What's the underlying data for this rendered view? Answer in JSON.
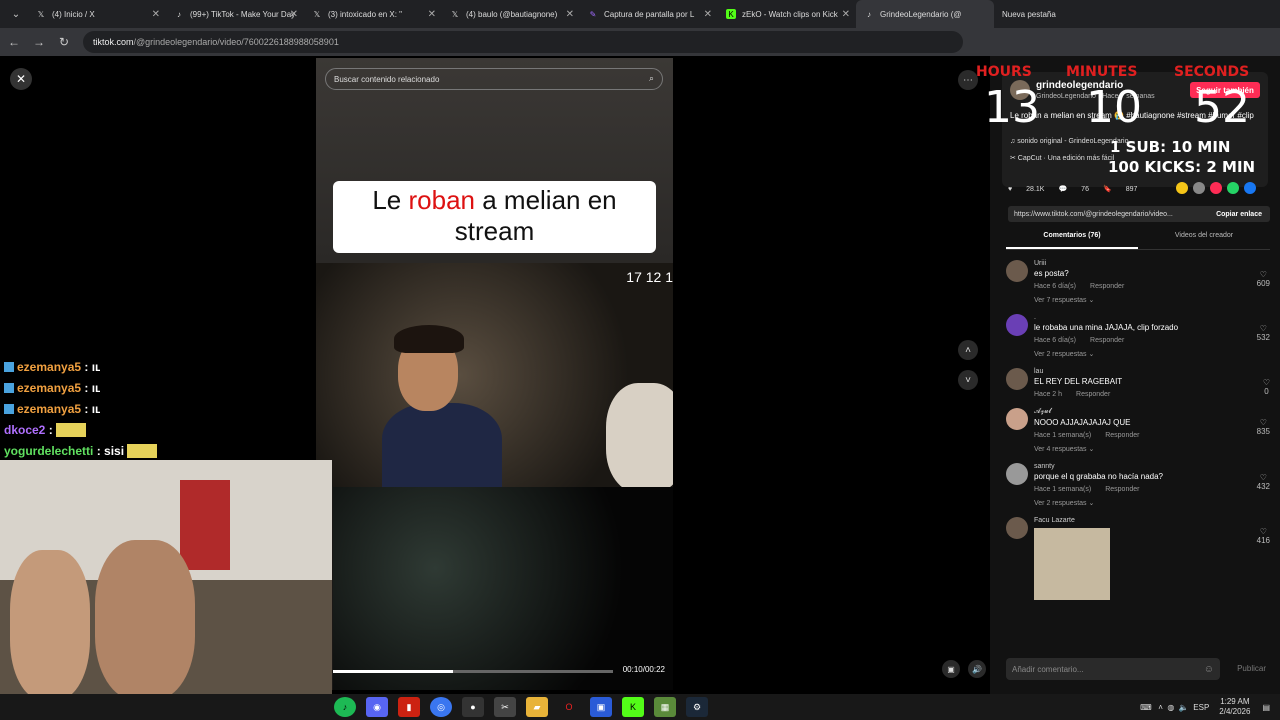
{
  "tabs": [
    {
      "label": "(4) Inicio / X",
      "icon": "x-logo-icon",
      "color": "#ffffff"
    },
    {
      "label": "(99+) TikTok - Make Your Day",
      "icon": "tiktok-logo-icon",
      "color": "#ffffff"
    },
    {
      "label": "(3) intoxicado en X: \"",
      "icon": "x-logo-icon",
      "color": "#ffffff"
    },
    {
      "label": "(4) baulo (@bautiagnone)",
      "icon": "x-logo-icon",
      "color": "#ffffff"
    },
    {
      "label": "Captura de pantalla por L",
      "icon": "pen-icon",
      "color": "#a06bff"
    },
    {
      "label": "zEkO - Watch clips on Kick",
      "icon": "kick-logo-icon",
      "color": "#53fc18"
    },
    {
      "label": "GrindeoLegendario (@",
      "icon": "tiktok-logo-icon",
      "color": "#ffffff",
      "active": true
    }
  ],
  "new_tab_label": "Nueva pestaña",
  "address": {
    "host": "tiktok.com",
    "path": "/@grindeolegendario/video/7600226188988058901"
  },
  "video": {
    "search_placeholder": "Buscar contenido relacionado",
    "caption_before": "Le ",
    "caption_red": "roban",
    "caption_after": " a melian en stream",
    "mini_timer": "17   12   1",
    "time": "00:10/00:22",
    "progress": 0.43
  },
  "chat": [
    {
      "user": "ezemanya5",
      "msg": "ıʟ",
      "color": "#f0a040"
    },
    {
      "user": "ezemanya5",
      "msg": "ıʟ",
      "color": "#f0a040"
    },
    {
      "user": "ezemanya5",
      "msg": "ıʟ",
      "color": "#f0a040"
    },
    {
      "user": "dkoce2",
      "msg": "",
      "color": "#b070ff"
    },
    {
      "user": "yogurdelechetti",
      "msg": "sisi",
      "color": "#60e060"
    }
  ],
  "author": {
    "username": "grindeolegendario",
    "subline": "GrindeoLegendario · Hace 7 semanas",
    "follow": "Seguir también",
    "desc": "Le roban a melian en stream 😭 #bautiagnone #stream #humor #clip",
    "tag": "#bautiagnone",
    "music": "♫  sonido original - GrindeoLegendario",
    "capcut": "✂  CapCut · Una edición más fácil"
  },
  "stats": {
    "likes": "28.1K",
    "comments": "76",
    "saves": "897"
  },
  "share_colors": [
    "#f5c518",
    "#888888",
    "#fe2c55",
    "#25d366",
    "#1877f2"
  ],
  "link": {
    "url": "https://www.tiktok.com/@grindeolegendario/video...",
    "copy": "Copiar enlace"
  },
  "comment_tabs": {
    "comments": "Comentarios (76)",
    "creator": "Videos del creador"
  },
  "comments": [
    {
      "name": "Uriii",
      "text": "es posta?",
      "time": "Hace 6 día(s)",
      "reply": "Responder",
      "replies": "Ver 7 respuestas ⌄",
      "likes": "609"
    },
    {
      "name": ".",
      "text": "le robaba una mina JAJAJA, clip forzado",
      "time": "Hace 6 día(s)",
      "reply": "Responder",
      "replies": "Ver 2 respuestas ⌄",
      "likes": "532"
    },
    {
      "name": "lau",
      "text": "EL REY DEL RAGEBAIT",
      "time": "Hace 2 h",
      "reply": "Responder",
      "replies": "",
      "likes": "0"
    },
    {
      "name": "𝓐𝔃𝓾𝓵",
      "text": "NOOO AJJAJAJAJAJ QUE",
      "time": "Hace 1 semana(s)",
      "reply": "Responder",
      "replies": "Ver 4 respuestas ⌄",
      "likes": "835"
    },
    {
      "name": "sannty",
      "text": "porque el q grababa no hacía nada?",
      "time": "Hace 1 semana(s)",
      "reply": "Responder",
      "replies": "Ver 2 respuestas ⌄",
      "likes": "432"
    },
    {
      "name": "Facu Lazarte",
      "text": "",
      "time": "",
      "reply": "",
      "replies": "",
      "likes": "416"
    }
  ],
  "add_comment_placeholder": "Añadir comentario...",
  "publish": "Publicar",
  "overlay": {
    "hours_label": "HOURS",
    "minutes_label": "MINUTES",
    "seconds_label": "SECONDS",
    "hours": "13",
    "minutes": "10",
    "seconds": "52",
    "line1": "1 SUB: 10 MIN",
    "line2": "100 KICKS: 2 MIN"
  },
  "tray": {
    "lang": "ESP",
    "time": "1:29 AM",
    "date": "2/4/2026"
  }
}
